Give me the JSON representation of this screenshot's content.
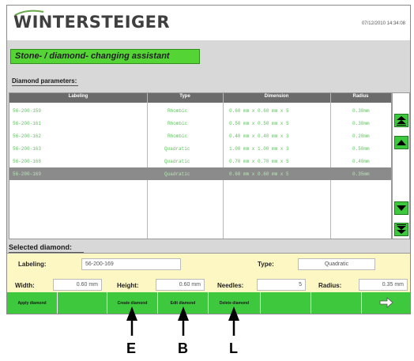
{
  "header": {
    "logo_text": "WINTERSTEIGER",
    "timestamp": "07/12/2010 14:34:08"
  },
  "title": "Stone- / diamond- changing assistant",
  "diamond_parameters_label": "Diamond parameters:",
  "table": {
    "columns": [
      "Labeling",
      "Type",
      "Dimension",
      "Radius"
    ],
    "rows": [
      {
        "labeling": "56-200-159",
        "type": "Rhombic",
        "dimension": "0.60 mm  x   0.60 mm  x  5",
        "radius": "0.30mm"
      },
      {
        "labeling": "56-200-161",
        "type": "Rhombic",
        "dimension": "0.50 mm  x   0.50 mm  x  5",
        "radius": "0.30mm"
      },
      {
        "labeling": "56-200-162",
        "type": "Rhombic",
        "dimension": "0.40 mm  x   0.40 mm  x  3",
        "radius": "0.20mm"
      },
      {
        "labeling": "56-200-163",
        "type": "Quadratic",
        "dimension": "1.00 mm  x   1.00 mm  x  3",
        "radius": "0.50mm"
      },
      {
        "labeling": "56-200-168",
        "type": "Quadratic",
        "dimension": "0.70 mm  x   0.70 mm  x  5",
        "radius": "0.40mm"
      },
      {
        "labeling": "56-200-169",
        "type": "Quadratic",
        "dimension": "0.60 mm  x   0.60 mm  x  5",
        "radius": "0.35mm"
      }
    ],
    "selected_index": 5
  },
  "selected": {
    "section_label": "Selected diamond:",
    "labeling_label": "Labeling:",
    "labeling_value": "56-200-169",
    "type_label": "Type:",
    "type_value": "Quadratic",
    "width_label": "Width:",
    "width_value": "0.60  mm",
    "height_label": "Height:",
    "height_value": "0.60  mm",
    "needles_label": "Needles:",
    "needles_value": "5",
    "radius_label": "Radius:",
    "radius_value": "0.35  mm"
  },
  "buttons": {
    "apply": "Apply diamond",
    "create": "Create diamond",
    "edit": "Edit diamond",
    "delete": "Delete diamond"
  },
  "callouts": [
    "E",
    "B",
    "L"
  ],
  "colors": {
    "accent_green": "#3ec83e",
    "title_green": "#55d535",
    "row_text_green": "#5fc55f",
    "selected_panel": "#fdf7c4"
  },
  "icons": [
    "scroll-top-icon",
    "scroll-up-icon",
    "scroll-down-icon",
    "scroll-bottom-icon",
    "arrow-right-icon"
  ]
}
